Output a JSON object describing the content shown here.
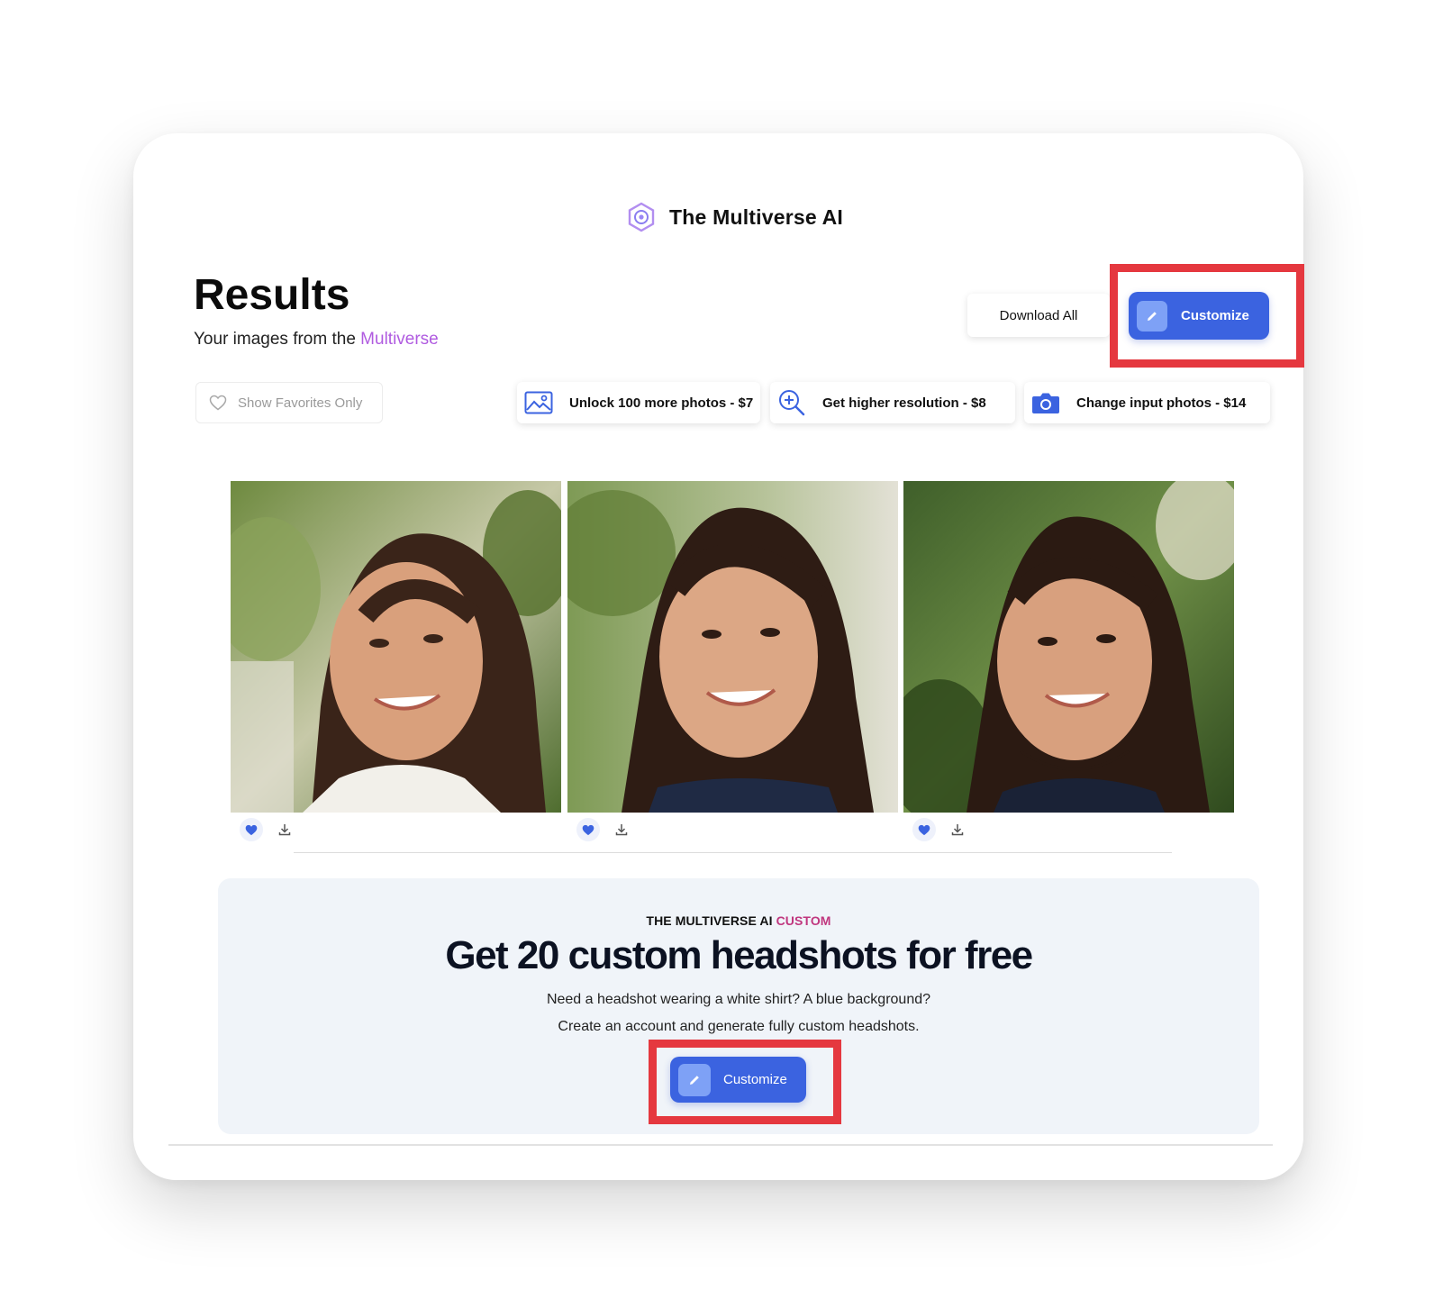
{
  "app": {
    "brand_name": "The Multiverse AI",
    "logo_icon": "hexagon-swirl-icon"
  },
  "header": {
    "title": "Results",
    "subtitle_prefix": "Your images from the ",
    "subtitle_accent": "Multiverse",
    "accent_color": "#b05be0"
  },
  "actions": {
    "download_all_label": "Download All",
    "customize_label": "Customize",
    "primary_color": "#3b63e0"
  },
  "filters": {
    "favorites_label": "Show Favorites Only"
  },
  "upsells": [
    {
      "icon": "image-icon",
      "label": "Unlock 100 more photos - $7"
    },
    {
      "icon": "zoom-in-icon",
      "label": "Get higher resolution - $8"
    },
    {
      "icon": "camera-icon",
      "label": "Change input photos - $14"
    }
  ],
  "gallery": [
    {
      "alt": "headshot-1",
      "favorited": true
    },
    {
      "alt": "headshot-2",
      "favorited": true
    },
    {
      "alt": "headshot-3",
      "favorited": true
    }
  ],
  "promo": {
    "eyebrow_prefix": "THE MULTIVERSE AI ",
    "eyebrow_accent": "CUSTOM",
    "eyebrow_accent_color": "#c0367e",
    "title": "Get 20 custom headshots for free",
    "line1": "Need a headshot wearing a white shirt? A blue background?",
    "line2": "Create an account and generate fully custom headshots.",
    "button_label": "Customize"
  },
  "annotations": {
    "highlight_color": "#e5383f"
  }
}
